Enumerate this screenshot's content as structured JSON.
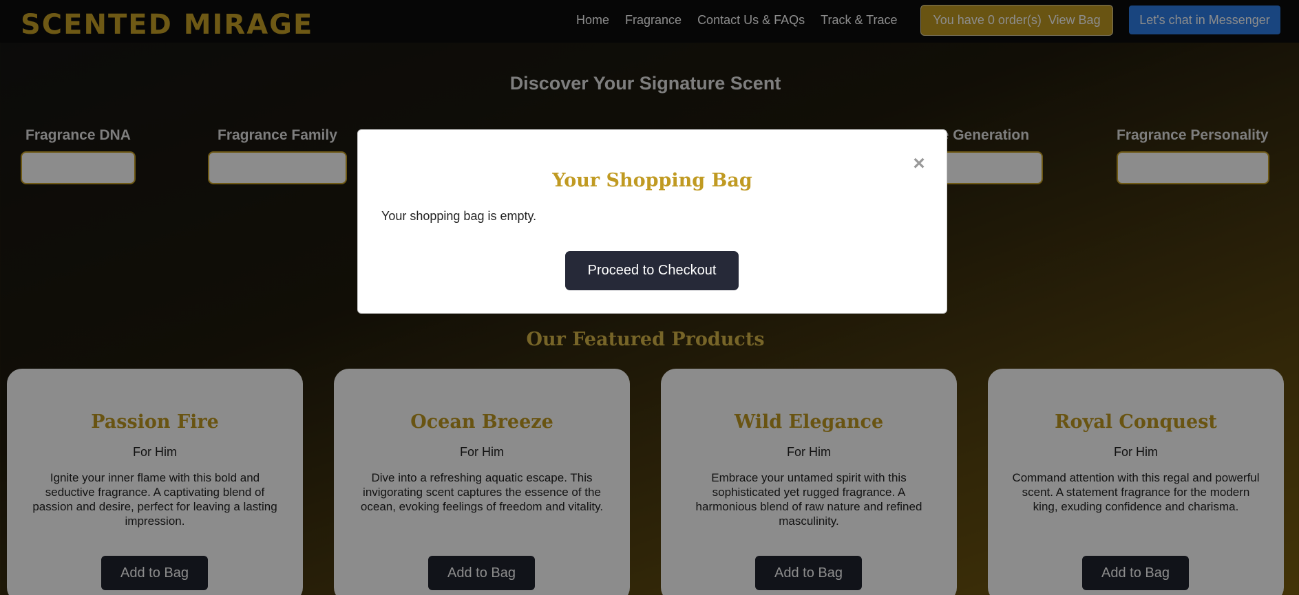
{
  "header": {
    "logo": "SCENTED MIRAGE",
    "nav": [
      "Home",
      "Fragrance",
      "Contact Us & FAQs",
      "Track & Trace"
    ],
    "bag_status": "You have 0 order(s)",
    "bag_link": "View Bag",
    "messenger": "Let's chat in Messenger"
  },
  "discover": {
    "title": "Discover Your Signature Scent",
    "fields": [
      "Fragrance DNA",
      "Fragrance Family",
      "ce Generation",
      "Fragrance Personality"
    ]
  },
  "featured": {
    "title": "Our Featured Products",
    "products": [
      {
        "name": "Passion Fire",
        "for": "For Him",
        "desc": "Ignite your inner flame with this bold and seductive fragrance. A captivating blend of passion and desire, perfect for leaving a lasting impression.",
        "button": "Add to Bag"
      },
      {
        "name": "Ocean Breeze",
        "for": "For Him",
        "desc": "Dive into a refreshing aquatic escape. This invigorating scent captures the essence of the ocean, evoking feelings of freedom and vitality.",
        "button": "Add to Bag"
      },
      {
        "name": "Wild Elegance",
        "for": "For Him",
        "desc": "Embrace your untamed spirit with this sophisticated yet rugged fragrance. A harmonious blend of raw nature and refined masculinity.",
        "button": "Add to Bag"
      },
      {
        "name": "Royal Conquest",
        "for": "For Him",
        "desc": "Command attention with this regal and powerful scent. A statement fragrance for the modern king, exuding confidence and charisma.",
        "button": "Add to Bag"
      }
    ]
  },
  "modal": {
    "close": "×",
    "title": "Your Shopping Bag",
    "empty_text": "Your shopping bag is empty.",
    "checkout": "Proceed to Checkout"
  },
  "colors": {
    "accent": "#c09a22",
    "header_bg": "#0b0b0b",
    "messenger": "#2f7fe8",
    "dark_button": "#20232f"
  }
}
